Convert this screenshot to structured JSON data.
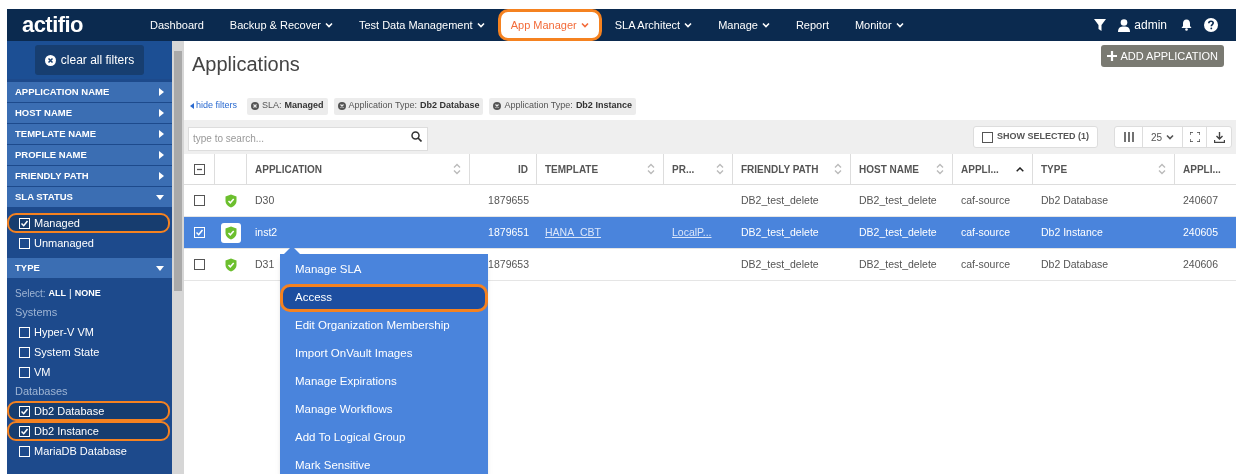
{
  "nav": {
    "logo": "actifio",
    "items": [
      {
        "label": "Dashboard",
        "dropdown": false,
        "selected": false,
        "highlighted": false
      },
      {
        "label": "Backup & Recover",
        "dropdown": true,
        "selected": false,
        "highlighted": false
      },
      {
        "label": "Test Data Management",
        "dropdown": true,
        "selected": false,
        "highlighted": false
      },
      {
        "label": "App Manager",
        "dropdown": true,
        "selected": true,
        "highlighted": true
      },
      {
        "label": "SLA Architect",
        "dropdown": true,
        "selected": false,
        "highlighted": false
      },
      {
        "label": "Manage",
        "dropdown": true,
        "selected": false,
        "highlighted": false
      },
      {
        "label": "Report",
        "dropdown": false,
        "selected": false,
        "highlighted": false
      },
      {
        "label": "Monitor",
        "dropdown": true,
        "selected": false,
        "highlighted": false
      }
    ],
    "user": "admin"
  },
  "sidebar": {
    "clear_button": "clear all filters",
    "sections": [
      {
        "title": "APPLICATION NAME",
        "expanded": false
      },
      {
        "title": "HOST NAME",
        "expanded": false
      },
      {
        "title": "TEMPLATE NAME",
        "expanded": false
      },
      {
        "title": "PROFILE NAME",
        "expanded": false
      },
      {
        "title": "FRIENDLY PATH",
        "expanded": false
      },
      {
        "title": "SLA STATUS",
        "expanded": true,
        "groups": [
          {
            "options": [
              {
                "label": "Managed",
                "checked": true,
                "highlighted": true
              },
              {
                "label": "Unmanaged",
                "checked": false,
                "highlighted": false
              }
            ]
          }
        ]
      },
      {
        "title": "TYPE",
        "expanded": true,
        "select": {
          "label": "Select:",
          "all": "ALL",
          "separator": "|",
          "none": "NONE"
        },
        "groups": [
          {
            "heading": "Systems",
            "options": [
              {
                "label": "Hyper-V VM",
                "checked": false,
                "highlighted": false
              },
              {
                "label": "System State",
                "checked": false,
                "highlighted": false
              },
              {
                "label": "VM",
                "checked": false,
                "highlighted": false
              }
            ]
          },
          {
            "heading": "Databases",
            "options": [
              {
                "label": "Db2 Database",
                "checked": true,
                "highlighted": true
              },
              {
                "label": "Db2 Instance",
                "checked": true,
                "highlighted": true
              },
              {
                "label": "MariaDB Database",
                "checked": false,
                "highlighted": false
              }
            ]
          }
        ]
      }
    ]
  },
  "main": {
    "title": "Applications",
    "add_button": "ADD APPLICATION",
    "hide_filters": "hide filters",
    "chips": [
      {
        "key": "SLA:",
        "value": "Managed"
      },
      {
        "key": "Application Type:",
        "value": "Db2 Database"
      },
      {
        "key": "Application Type:",
        "value": "Db2 Instance"
      }
    ],
    "search": {
      "placeholder": "type to search..."
    },
    "show_selected": {
      "label": "SHOW SELECTED (1)",
      "checked": false
    },
    "page_size": "25",
    "select_all": {
      "indeterminate": true
    },
    "columns": [
      {
        "label": "APPLICATION",
        "sortable": true,
        "sorted": false
      },
      {
        "label": "ID",
        "sortable": false,
        "sorted": false
      },
      {
        "label": "TEMPLATE",
        "sortable": true,
        "sorted": false
      },
      {
        "label": "PR...",
        "sortable": true,
        "sorted": false
      },
      {
        "label": "FRIENDLY PATH",
        "sortable": true,
        "sorted": false
      },
      {
        "label": "HOST NAME",
        "sortable": true,
        "sorted": false
      },
      {
        "label": "APPLI...",
        "sortable": true,
        "sorted": true
      },
      {
        "label": "TYPE",
        "sortable": true,
        "sorted": false
      },
      {
        "label": "APPLI...",
        "sortable": false,
        "sorted": false
      }
    ],
    "rows": [
      {
        "selected": false,
        "cells": [
          "D30",
          "1879655",
          "",
          "",
          "DB2_test_delete",
          "DB2_test_delete",
          "caf-source",
          "Db2 Database",
          "240607"
        ]
      },
      {
        "selected": true,
        "cells": [
          "inst2",
          "1879651",
          "HANA_CBT",
          "LocalP...",
          "DB2_test_delete",
          "DB2_test_delete",
          "caf-source",
          "Db2 Instance",
          "240605"
        ]
      },
      {
        "selected": false,
        "cells": [
          "D31",
          "1879653",
          "",
          "",
          "DB2_test_delete",
          "DB2_test_delete",
          "caf-source",
          "Db2 Database",
          "240606"
        ]
      }
    ],
    "context_menu": [
      {
        "label": "Manage SLA",
        "selected": false,
        "highlighted": false
      },
      {
        "label": "Access",
        "selected": true,
        "highlighted": true
      },
      {
        "label": "Edit Organization Membership",
        "selected": false,
        "highlighted": false
      },
      {
        "label": "Import OnVault Images",
        "selected": false,
        "highlighted": false
      },
      {
        "label": "Manage Expirations",
        "selected": false,
        "highlighted": false
      },
      {
        "label": "Manage Workflows",
        "selected": false,
        "highlighted": false
      },
      {
        "label": "Add To Logical Group",
        "selected": false,
        "highlighted": false
      },
      {
        "label": "Mark Sensitive",
        "selected": false,
        "highlighted": false
      }
    ]
  }
}
